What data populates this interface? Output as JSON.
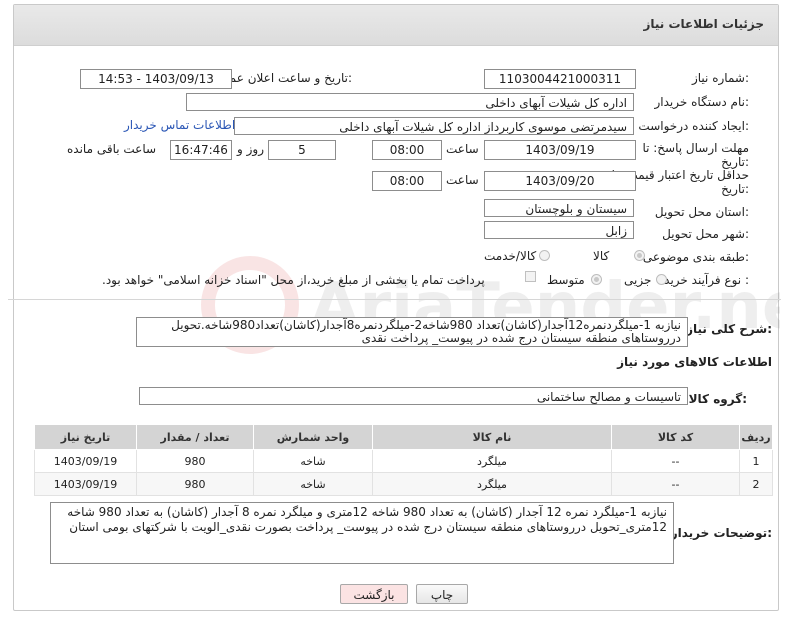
{
  "header": {
    "title": "جزئیات اطلاعات نیاز"
  },
  "need_number": {
    "label": "شماره نیاز:",
    "value": "1103004421000311"
  },
  "announce_datetime": {
    "label": "تاریخ و ساعت اعلان عمومی:",
    "value": "1403/09/13 - 14:53"
  },
  "buyer_org": {
    "label": "نام دستگاه خریدار:",
    "value": "اداره کل شیلات آبهای داخلی"
  },
  "requester": {
    "label": "ایجاد کننده درخواست:",
    "value": "سیدمرتضی موسوی کاربرداز اداره کل شیلات آبهای داخلی",
    "contact_link": "اطلاعات تماس خریدار"
  },
  "deadline_send": {
    "label_line1": "مهلت ارسال پاسخ: تا",
    "label_line2": "تاریخ:",
    "date": "1403/09/19",
    "time_label": "ساعت",
    "time": "08:00",
    "days": "5",
    "days_label": "روز و",
    "remaining_time": "16:47:46",
    "remaining_label": "ساعت باقی مانده"
  },
  "price_validity": {
    "label_line1": "حداقل تاریخ اعتبار قیمت: تا",
    "label_line2": "تاریخ:",
    "date": "1403/09/20",
    "time_label": "ساعت",
    "time": "08:00"
  },
  "delivery_province": {
    "label": "استان محل تحویل:",
    "value": "سیستان و بلوچستان"
  },
  "delivery_city": {
    "label": "شهر محل تحویل:",
    "value": "زابل"
  },
  "subject_class": {
    "label": "طبقه بندی موضوعی:",
    "options": [
      "کالا",
      "کالا/خدمت"
    ]
  },
  "purchase_type": {
    "label": "نوع فرآیند خرید :",
    "options": [
      "جزیی",
      "متوسط"
    ],
    "note": "پرداخت تمام یا بخشی از مبلغ خرید،از محل \"اسناد خزانه اسلامی\" خواهد بود."
  },
  "general_description": {
    "label": "شرح کلی نیاز:",
    "text": "نیازبه 1-میلگردنمره12آجدار(کاشان)تعداد 980شاخه2-میلگردنمره8آجدار(کاشان)تعداد980شاخه.تحویل درروستاهای منطقه سیستان درج شده در پیوست_ پرداخت نقدی"
  },
  "goods_info": {
    "title": "اطلاعات کالاهای مورد نیاز"
  },
  "goods_group": {
    "label": "گروه کالا:",
    "value": "تاسیسات و مصالح ساختمانی"
  },
  "table": {
    "headers": [
      "ردیف",
      "کد کالا",
      "نام کالا",
      "واحد شمارش",
      "تعداد / مقدار",
      "تاریخ نیاز"
    ],
    "rows": [
      [
        "1",
        "--",
        "میلگرد",
        "شاخه",
        "980",
        "1403/09/19"
      ],
      [
        "2",
        "--",
        "میلگرد",
        "شاخه",
        "980",
        "1403/09/19"
      ]
    ]
  },
  "buyer_notes": {
    "label": "توضیحات خریدار:",
    "text": "نیازبه 1-میلگرد نمره 12 آجدار (کاشان) به تعداد 980 شاخه 12متری و میلگرد نمره 8 آجدار (کاشان) به تعداد 980 شاخه 12متری_تحویل درروستاهای منطقه سیستان درج شده در پیوست_ پرداخت بصورت نقدی_الویت با شرکتهای بومی استان"
  },
  "buttons": {
    "print": "چاپ",
    "back": "بازگشت"
  },
  "watermark_text": "AriaTender.neT",
  "colors": {
    "link": "#2a56b5",
    "back_button_bg": "#fbe3e3"
  }
}
